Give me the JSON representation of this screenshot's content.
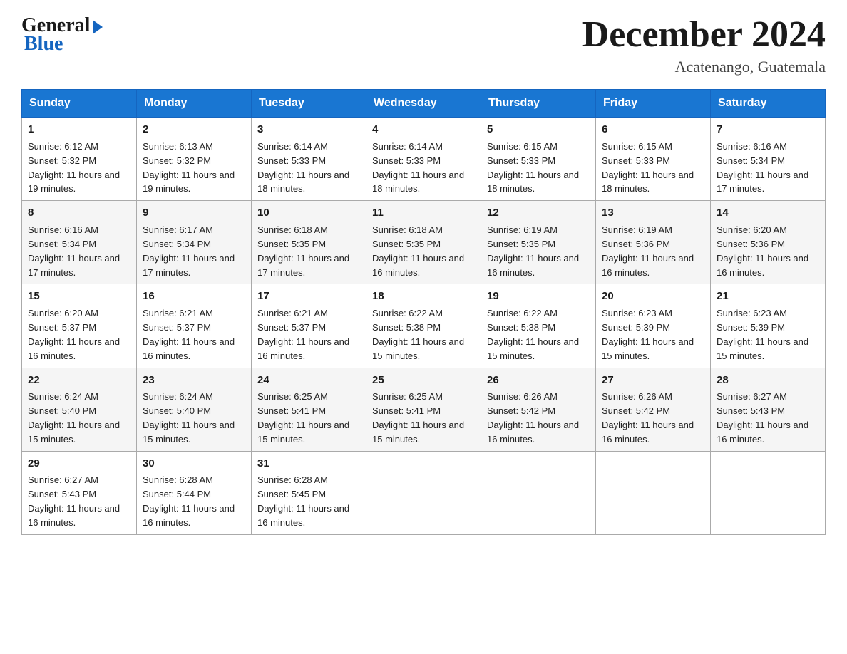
{
  "logo": {
    "general": "General",
    "blue": "Blue"
  },
  "header": {
    "month_title": "December 2024",
    "location": "Acatenango, Guatemala"
  },
  "weekdays": [
    "Sunday",
    "Monday",
    "Tuesday",
    "Wednesday",
    "Thursday",
    "Friday",
    "Saturday"
  ],
  "weeks": [
    [
      {
        "day": "1",
        "sunrise": "6:12 AM",
        "sunset": "5:32 PM",
        "daylight": "11 hours and 19 minutes."
      },
      {
        "day": "2",
        "sunrise": "6:13 AM",
        "sunset": "5:32 PM",
        "daylight": "11 hours and 19 minutes."
      },
      {
        "day": "3",
        "sunrise": "6:14 AM",
        "sunset": "5:33 PM",
        "daylight": "11 hours and 18 minutes."
      },
      {
        "day": "4",
        "sunrise": "6:14 AM",
        "sunset": "5:33 PM",
        "daylight": "11 hours and 18 minutes."
      },
      {
        "day": "5",
        "sunrise": "6:15 AM",
        "sunset": "5:33 PM",
        "daylight": "11 hours and 18 minutes."
      },
      {
        "day": "6",
        "sunrise": "6:15 AM",
        "sunset": "5:33 PM",
        "daylight": "11 hours and 18 minutes."
      },
      {
        "day": "7",
        "sunrise": "6:16 AM",
        "sunset": "5:34 PM",
        "daylight": "11 hours and 17 minutes."
      }
    ],
    [
      {
        "day": "8",
        "sunrise": "6:16 AM",
        "sunset": "5:34 PM",
        "daylight": "11 hours and 17 minutes."
      },
      {
        "day": "9",
        "sunrise": "6:17 AM",
        "sunset": "5:34 PM",
        "daylight": "11 hours and 17 minutes."
      },
      {
        "day": "10",
        "sunrise": "6:18 AM",
        "sunset": "5:35 PM",
        "daylight": "11 hours and 17 minutes."
      },
      {
        "day": "11",
        "sunrise": "6:18 AM",
        "sunset": "5:35 PM",
        "daylight": "11 hours and 16 minutes."
      },
      {
        "day": "12",
        "sunrise": "6:19 AM",
        "sunset": "5:35 PM",
        "daylight": "11 hours and 16 minutes."
      },
      {
        "day": "13",
        "sunrise": "6:19 AM",
        "sunset": "5:36 PM",
        "daylight": "11 hours and 16 minutes."
      },
      {
        "day": "14",
        "sunrise": "6:20 AM",
        "sunset": "5:36 PM",
        "daylight": "11 hours and 16 minutes."
      }
    ],
    [
      {
        "day": "15",
        "sunrise": "6:20 AM",
        "sunset": "5:37 PM",
        "daylight": "11 hours and 16 minutes."
      },
      {
        "day": "16",
        "sunrise": "6:21 AM",
        "sunset": "5:37 PM",
        "daylight": "11 hours and 16 minutes."
      },
      {
        "day": "17",
        "sunrise": "6:21 AM",
        "sunset": "5:37 PM",
        "daylight": "11 hours and 16 minutes."
      },
      {
        "day": "18",
        "sunrise": "6:22 AM",
        "sunset": "5:38 PM",
        "daylight": "11 hours and 15 minutes."
      },
      {
        "day": "19",
        "sunrise": "6:22 AM",
        "sunset": "5:38 PM",
        "daylight": "11 hours and 15 minutes."
      },
      {
        "day": "20",
        "sunrise": "6:23 AM",
        "sunset": "5:39 PM",
        "daylight": "11 hours and 15 minutes."
      },
      {
        "day": "21",
        "sunrise": "6:23 AM",
        "sunset": "5:39 PM",
        "daylight": "11 hours and 15 minutes."
      }
    ],
    [
      {
        "day": "22",
        "sunrise": "6:24 AM",
        "sunset": "5:40 PM",
        "daylight": "11 hours and 15 minutes."
      },
      {
        "day": "23",
        "sunrise": "6:24 AM",
        "sunset": "5:40 PM",
        "daylight": "11 hours and 15 minutes."
      },
      {
        "day": "24",
        "sunrise": "6:25 AM",
        "sunset": "5:41 PM",
        "daylight": "11 hours and 15 minutes."
      },
      {
        "day": "25",
        "sunrise": "6:25 AM",
        "sunset": "5:41 PM",
        "daylight": "11 hours and 15 minutes."
      },
      {
        "day": "26",
        "sunrise": "6:26 AM",
        "sunset": "5:42 PM",
        "daylight": "11 hours and 16 minutes."
      },
      {
        "day": "27",
        "sunrise": "6:26 AM",
        "sunset": "5:42 PM",
        "daylight": "11 hours and 16 minutes."
      },
      {
        "day": "28",
        "sunrise": "6:27 AM",
        "sunset": "5:43 PM",
        "daylight": "11 hours and 16 minutes."
      }
    ],
    [
      {
        "day": "29",
        "sunrise": "6:27 AM",
        "sunset": "5:43 PM",
        "daylight": "11 hours and 16 minutes."
      },
      {
        "day": "30",
        "sunrise": "6:28 AM",
        "sunset": "5:44 PM",
        "daylight": "11 hours and 16 minutes."
      },
      {
        "day": "31",
        "sunrise": "6:28 AM",
        "sunset": "5:45 PM",
        "daylight": "11 hours and 16 minutes."
      },
      null,
      null,
      null,
      null
    ]
  ],
  "labels": {
    "sunrise": "Sunrise:",
    "sunset": "Sunset:",
    "daylight": "Daylight:"
  }
}
